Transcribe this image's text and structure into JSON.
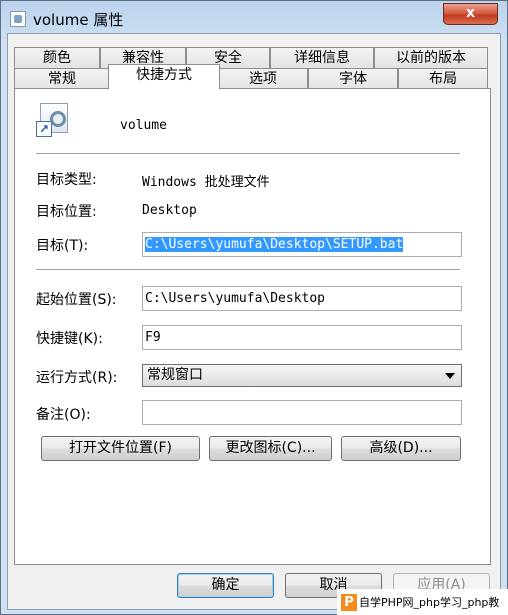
{
  "window": {
    "title": "volume 属性",
    "close_label": "x"
  },
  "tabs": {
    "row_back": [
      "颜色",
      "兼容性",
      "安全",
      "详细信息",
      "以前的版本"
    ],
    "row_front": [
      "常规",
      "快捷方式",
      "选项",
      "字体",
      "布局"
    ],
    "active": "快捷方式"
  },
  "shortcut": {
    "name": "volume",
    "target_type_label": "目标类型:",
    "target_type_value": "Windows 批处理文件",
    "target_location_label": "目标位置:",
    "target_location_value": "Desktop",
    "target_label": "目标(T):",
    "target_value": "C:\\Users\\yumufa\\Desktop\\SETUP.bat",
    "start_in_label": "起始位置(S):",
    "start_in_value": "C:\\Users\\yumufa\\Desktop",
    "hotkey_label": "快捷键(K):",
    "hotkey_value": "F9",
    "run_label": "运行方式(R):",
    "run_value": "常规窗口",
    "comment_label": "备注(O):",
    "comment_value": "",
    "open_location_button": "打开文件位置(F)",
    "change_icon_button": "更改图标(C)...",
    "advanced_button": "高级(D)..."
  },
  "dialog_buttons": {
    "ok": "确定",
    "cancel": "取消",
    "apply": "应用(A)"
  },
  "watermark": {
    "logo": "P",
    "text": "自学PHP网_php学习_php教"
  }
}
